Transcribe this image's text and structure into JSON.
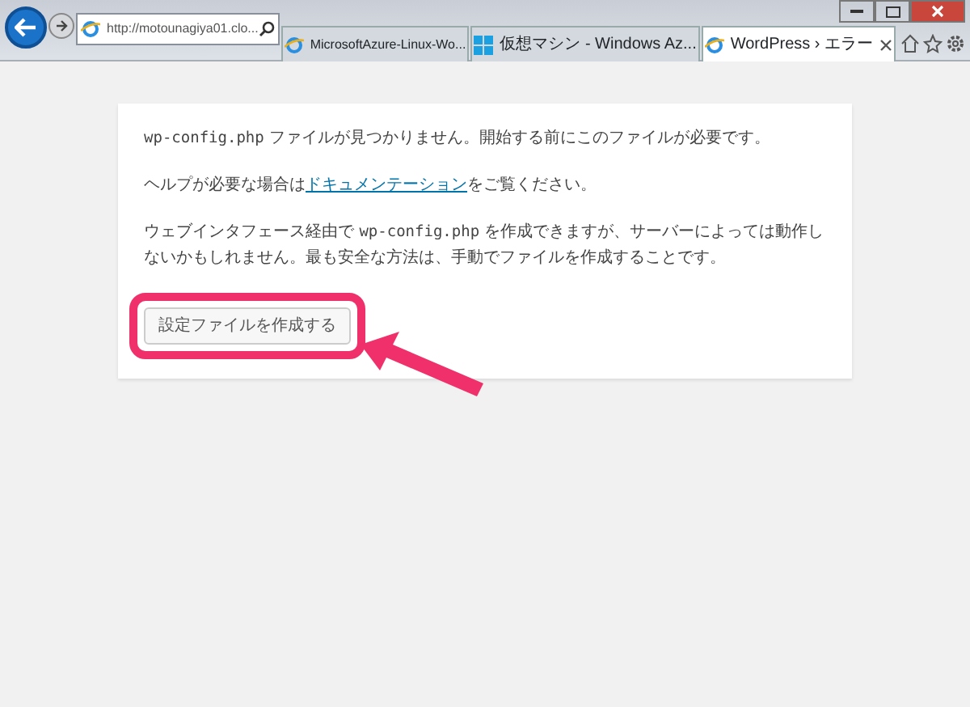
{
  "browser": {
    "address": "http://motounagiya01.clo...",
    "tabs": [
      {
        "label": "MicrosoftAzure-Linux-Wo...",
        "selected": false
      },
      {
        "label": "仮想マシン - Windows Az...",
        "selected": false
      },
      {
        "label": "WordPress › エラー",
        "selected": true
      }
    ]
  },
  "page": {
    "paragraphs": [
      [
        {
          "kind": "code",
          "text": "wp-config.php"
        },
        {
          "kind": "text",
          "text": " ファイルが見つかりません。開始する前にこのファイルが必要です。"
        }
      ],
      [
        {
          "kind": "text",
          "text": "ヘルプが必要な場合は"
        },
        {
          "kind": "link",
          "text": "ドキュメンテーション"
        },
        {
          "kind": "text",
          "text": "をご覧ください。"
        }
      ],
      [
        {
          "kind": "text",
          "text": "ウェブインタフェース経由で "
        },
        {
          "kind": "code",
          "text": "wp-config.php"
        },
        {
          "kind": "text",
          "text": " を作成できますが、サーバーによっては動作しないかもしれません。最も安全な方法は、手動でファイルを作成することです。"
        }
      ]
    ],
    "button": "設定ファイルを作成する"
  }
}
